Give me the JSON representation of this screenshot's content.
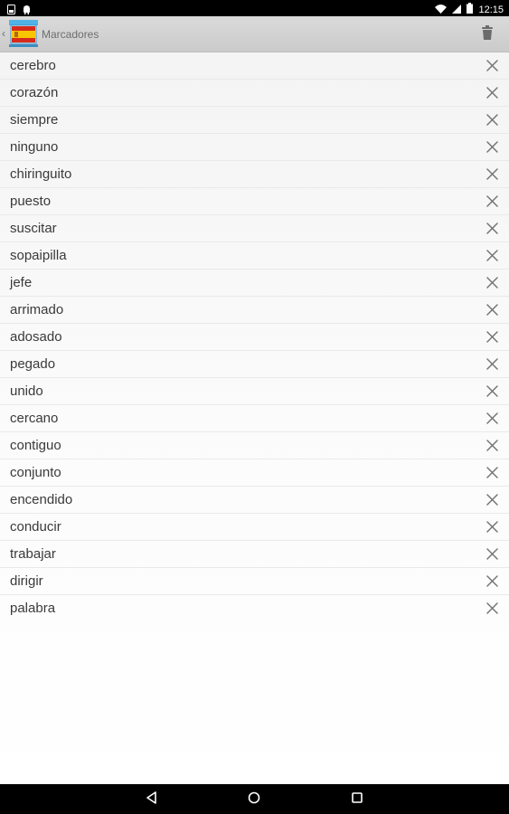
{
  "status_bar": {
    "time": "12:15",
    "left_icons": [
      "sim-card-icon",
      "android-icon"
    ],
    "right_icons": [
      "wifi-icon",
      "signal-icon",
      "battery-icon"
    ]
  },
  "action_bar": {
    "title": "Marcadores",
    "app_icon": "spanish-flag-icon",
    "delete_all_icon": "trash-icon"
  },
  "bookmarks": [
    "cerebro",
    "corazón",
    "siempre",
    "ninguno",
    "chiringuito",
    "puesto",
    "suscitar",
    "sopaipilla",
    "jefe",
    "arrimado",
    "adosado",
    "pegado",
    "unido",
    "cercano",
    "contiguo",
    "conjunto",
    "encendido",
    "conducir",
    "trabajar",
    "dirigir",
    "palabra"
  ],
  "nav_bar": {
    "icons": [
      "back-icon",
      "home-icon",
      "recents-icon"
    ]
  },
  "colors": {
    "status_bar": "#000000",
    "action_bar": "#d2d2d2",
    "text": "#3a3a3a",
    "delete_icon": "#757575"
  }
}
